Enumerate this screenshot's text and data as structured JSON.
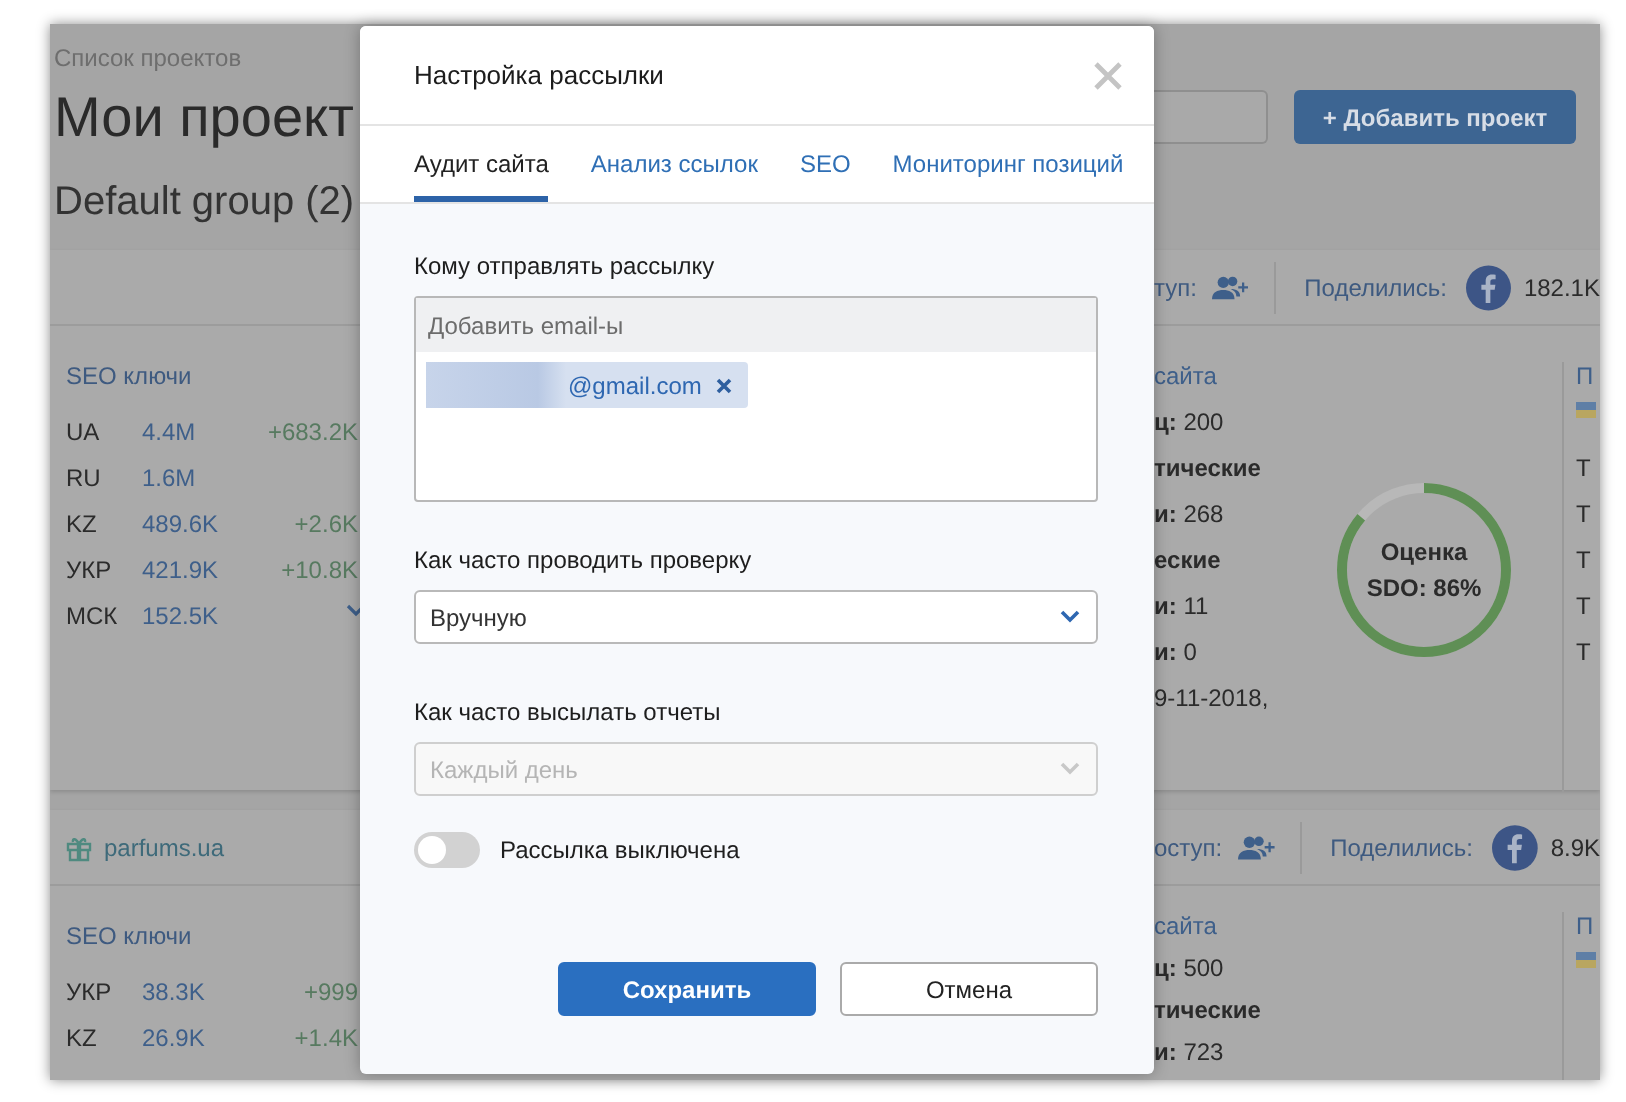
{
  "background": {
    "breadcrumb": "Список проектов",
    "title": "Мои проект",
    "group": "Default group (2)",
    "add_button": "+ Добавить проект",
    "projects": [
      {
        "access_label": "туп:",
        "shared_label": "Поделились:",
        "shares": "182.1K",
        "seo_title": "SEO ключи",
        "more": true,
        "keywords": [
          {
            "region": "UA",
            "count": "4.4M",
            "change": "+683.2K"
          },
          {
            "region": "RU",
            "count": "1.6M"
          },
          {
            "region": "KZ",
            "count": "489.6K",
            "change": "+2.6K"
          },
          {
            "region": "УКР",
            "count": "421.9K",
            "change": "+10.8K"
          },
          {
            "region": "МСК",
            "count": "152.5K"
          }
        ],
        "audit_title": "сайта",
        "audit_lines": [
          {
            "text": "**ц:** 200",
            "bold": false
          },
          {
            "text": "тические",
            "bold": true
          },
          {
            "text": "**и:** 268",
            "bold": false
          },
          {
            "text": "еские",
            "bold": true
          },
          {
            "text": "**и:** 11",
            "bold": false
          },
          {
            "text": "**и:** 0",
            "bold": false
          },
          {
            "text": "9-11-2018,",
            "bold": false
          }
        ],
        "score": {
          "label": "Оценка",
          "value": "SDO: 86%",
          "level": 0.86
        },
        "side_title": "П",
        "side_lines": [
          "Т",
          "Т",
          "Т",
          "Т",
          "Т"
        ]
      },
      {
        "name": "parfums.ua",
        "access_label": "оступ:",
        "shared_label": "Поделились:",
        "shares": "8.9K",
        "seo_title": "SEO ключи",
        "more": false,
        "keywords": [
          {
            "region": "УКР",
            "count": "38.3K",
            "change": "+999"
          },
          {
            "region": "KZ",
            "count": "26.9K",
            "change": "+1.4K"
          }
        ],
        "audit_title": "сайта",
        "audit_lines": [
          {
            "text": "**ц:** 500",
            "bold": false
          },
          {
            "text": "тические",
            "bold": true
          },
          {
            "text": "**и:** 723",
            "bold": false
          }
        ],
        "side_title": "П"
      }
    ]
  },
  "dialog": {
    "title": "Настройка рассылки",
    "tabs": [
      {
        "label": "Аудит сайта",
        "selected": true
      },
      {
        "label": "Анализ ссылок",
        "selected": false
      },
      {
        "label": "SEO",
        "selected": false
      },
      {
        "label": "Мониторинг позиций",
        "selected": false
      }
    ],
    "recipients": {
      "label": "Кому отправлять рассылку",
      "placeholder": "Добавить email-ы",
      "emails": [
        "@gmail.com"
      ]
    },
    "check_frequency": {
      "label": "Как часто проводить проверку",
      "value": "Вручную",
      "disabled": false
    },
    "report_frequency": {
      "label": "Как часто высылать отчеты",
      "value": "Каждый день",
      "disabled": true
    },
    "toggle": {
      "label": "Рассылка выключена",
      "on": false
    },
    "buttons": [
      {
        "label": "Сохранить",
        "kind": "primary"
      },
      {
        "label": "Отмена",
        "kind": "secondary"
      }
    ]
  }
}
